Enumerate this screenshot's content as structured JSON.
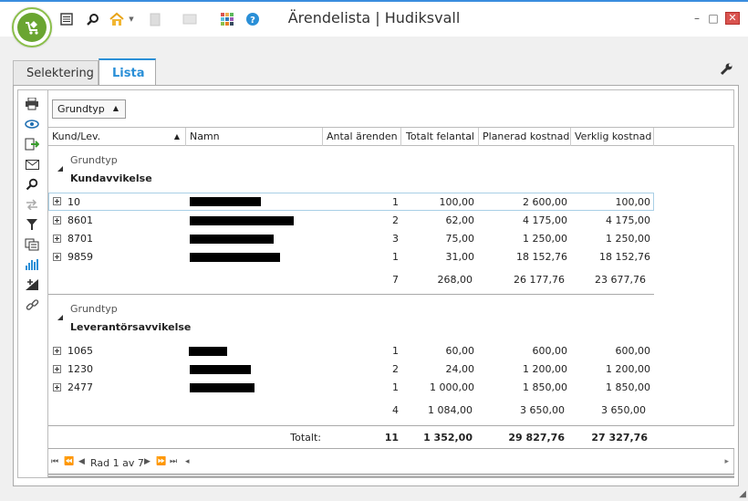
{
  "window": {
    "title": "Ärendelista | Hudiksvall"
  },
  "tabs": [
    {
      "label": "Selektering",
      "active": false
    },
    {
      "label": "Lista",
      "active": true
    }
  ],
  "group_panel": {
    "chip_label": "Grundtyp"
  },
  "columns": [
    {
      "label": "Kund/Lev."
    },
    {
      "label": "Namn"
    },
    {
      "label": "Antal ärenden"
    },
    {
      "label": "Totalt felantal"
    },
    {
      "label": "Planerad kostnad"
    },
    {
      "label": "Verklig kostnad"
    }
  ],
  "groups": [
    {
      "caption": "Grundtyp",
      "value": "Kundavvikelse",
      "rows": [
        {
          "id": "10",
          "antal": "1",
          "felantal": "100,00",
          "planerad": "2 600,00",
          "verklig": "100,00"
        },
        {
          "id": "8601",
          "antal": "2",
          "felantal": "62,00",
          "planerad": "4 175,00",
          "verklig": "4 175,00"
        },
        {
          "id": "8701",
          "antal": "3",
          "felantal": "75,00",
          "planerad": "1 250,00",
          "verklig": "1 250,00"
        },
        {
          "id": "9859",
          "antal": "1",
          "felantal": "31,00",
          "planerad": "18 152,76",
          "verklig": "18 152,76"
        }
      ],
      "summary": {
        "antal": "7",
        "felantal": "268,00",
        "planerad": "26 177,76",
        "verklig": "23 677,76"
      }
    },
    {
      "caption": "Grundtyp",
      "value": "Leverantörsavvikelse",
      "rows": [
        {
          "id": "1065",
          "antal": "1",
          "felantal": "60,00",
          "planerad": "600,00",
          "verklig": "600,00"
        },
        {
          "id": "1230",
          "antal": "2",
          "felantal": "24,00",
          "planerad": "1 200,00",
          "verklig": "1 200,00"
        },
        {
          "id": "2477",
          "antal": "1",
          "felantal": "1 000,00",
          "planerad": "1 850,00",
          "verklig": "1 850,00"
        }
      ],
      "summary": {
        "antal": "4",
        "felantal": "1 084,00",
        "planerad": "3 650,00",
        "verklig": "3 650,00"
      }
    }
  ],
  "totals": {
    "label": "Totalt:",
    "antal": "11",
    "felantal": "1 352,00",
    "planerad": "29 827,76",
    "verklig": "27 327,76"
  },
  "navigator": {
    "position_text": "Rad 1 av 7"
  },
  "colors": {
    "accent": "#2a8fd7",
    "logo_green": "#6aa531",
    "close_red": "#d9534f"
  }
}
